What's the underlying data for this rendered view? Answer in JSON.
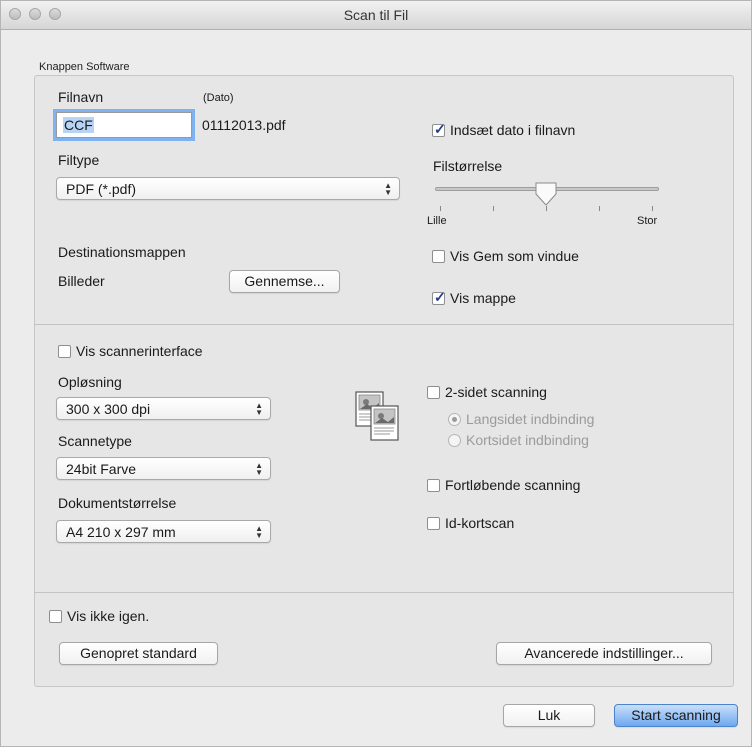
{
  "window": {
    "title": "Scan til Fil"
  },
  "group": {
    "label": "Knappen Software"
  },
  "filename": {
    "label": "Filnavn",
    "date_label": "(Dato)",
    "value": "CCF",
    "suffix": "01112013.pdf"
  },
  "filetype": {
    "label": "Filtype",
    "selected": "PDF (*.pdf)"
  },
  "insert_date": {
    "label": "Indsæt dato i filnavn",
    "checked": true
  },
  "filesize": {
    "label": "Filstørrelse",
    "min_label": "Lille",
    "max_label": "Stor",
    "level": 0.5
  },
  "destination": {
    "label": "Destinationsmappen",
    "folder": "Billeder",
    "browse_label": "Gennemse..."
  },
  "show_save_as": {
    "label": "Vis Gem som vindue",
    "checked": false
  },
  "show_folder": {
    "label": "Vis mappe",
    "checked": true
  },
  "show_scanner_interface": {
    "label": "Vis scannerinterface",
    "checked": false
  },
  "resolution": {
    "label": "Opløsning",
    "selected": "300 x 300 dpi"
  },
  "scan_type": {
    "label": "Scannetype",
    "selected": "24bit Farve"
  },
  "document_size": {
    "label": "Dokumentstørrelse",
    "selected": "A4 210 x 297 mm"
  },
  "duplex": {
    "label": "2-sidet scanning",
    "checked": false,
    "options": [
      {
        "label": "Langsidet indbinding",
        "selected": true
      },
      {
        "label": "Kortsidet indbinding",
        "selected": false
      }
    ]
  },
  "continuous_scan": {
    "label": "Fortløbende scanning",
    "checked": false
  },
  "id_card_scan": {
    "label": "Id-kortscan",
    "checked": false
  },
  "dont_show_again": {
    "label": "Vis ikke igen.",
    "checked": false
  },
  "buttons": {
    "restore_defaults": "Genopret standard",
    "advanced_settings": "Avancerede indstillinger...",
    "close": "Luk",
    "start_scan": "Start scanning"
  },
  "icons": {
    "duplex": "duplex-scan-icon",
    "dropdown": "chevron-updown-icon",
    "checkbox": "checkmark-icon"
  },
  "colors": {
    "accent": "#6ea8f0",
    "focus_ring": "#7fb2f0",
    "text_selection": "#b8d4f5"
  }
}
